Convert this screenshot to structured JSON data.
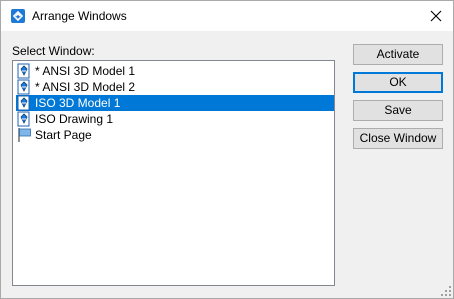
{
  "window": {
    "title": "Arrange Windows",
    "app_icon": "app-logo-icon",
    "close_icon": "close-icon"
  },
  "list": {
    "label": "Select Window:",
    "items": [
      {
        "label": "* ANSI 3D Model 1",
        "icon": "model-doc-icon",
        "selected": false
      },
      {
        "label": "* ANSI 3D Model 2",
        "icon": "model-doc-icon",
        "selected": false
      },
      {
        "label": "ISO 3D Model 1",
        "icon": "model-doc-icon",
        "selected": true
      },
      {
        "label": "ISO Drawing 1",
        "icon": "model-doc-icon",
        "selected": false
      },
      {
        "label": "Start Page",
        "icon": "start-page-flag-icon",
        "selected": false
      }
    ]
  },
  "buttons": {
    "activate": "Activate",
    "ok": "OK",
    "save": "Save",
    "close_window": "Close Window"
  },
  "colors": {
    "selection": "#0078d7",
    "accent": "#1e7ad6"
  }
}
